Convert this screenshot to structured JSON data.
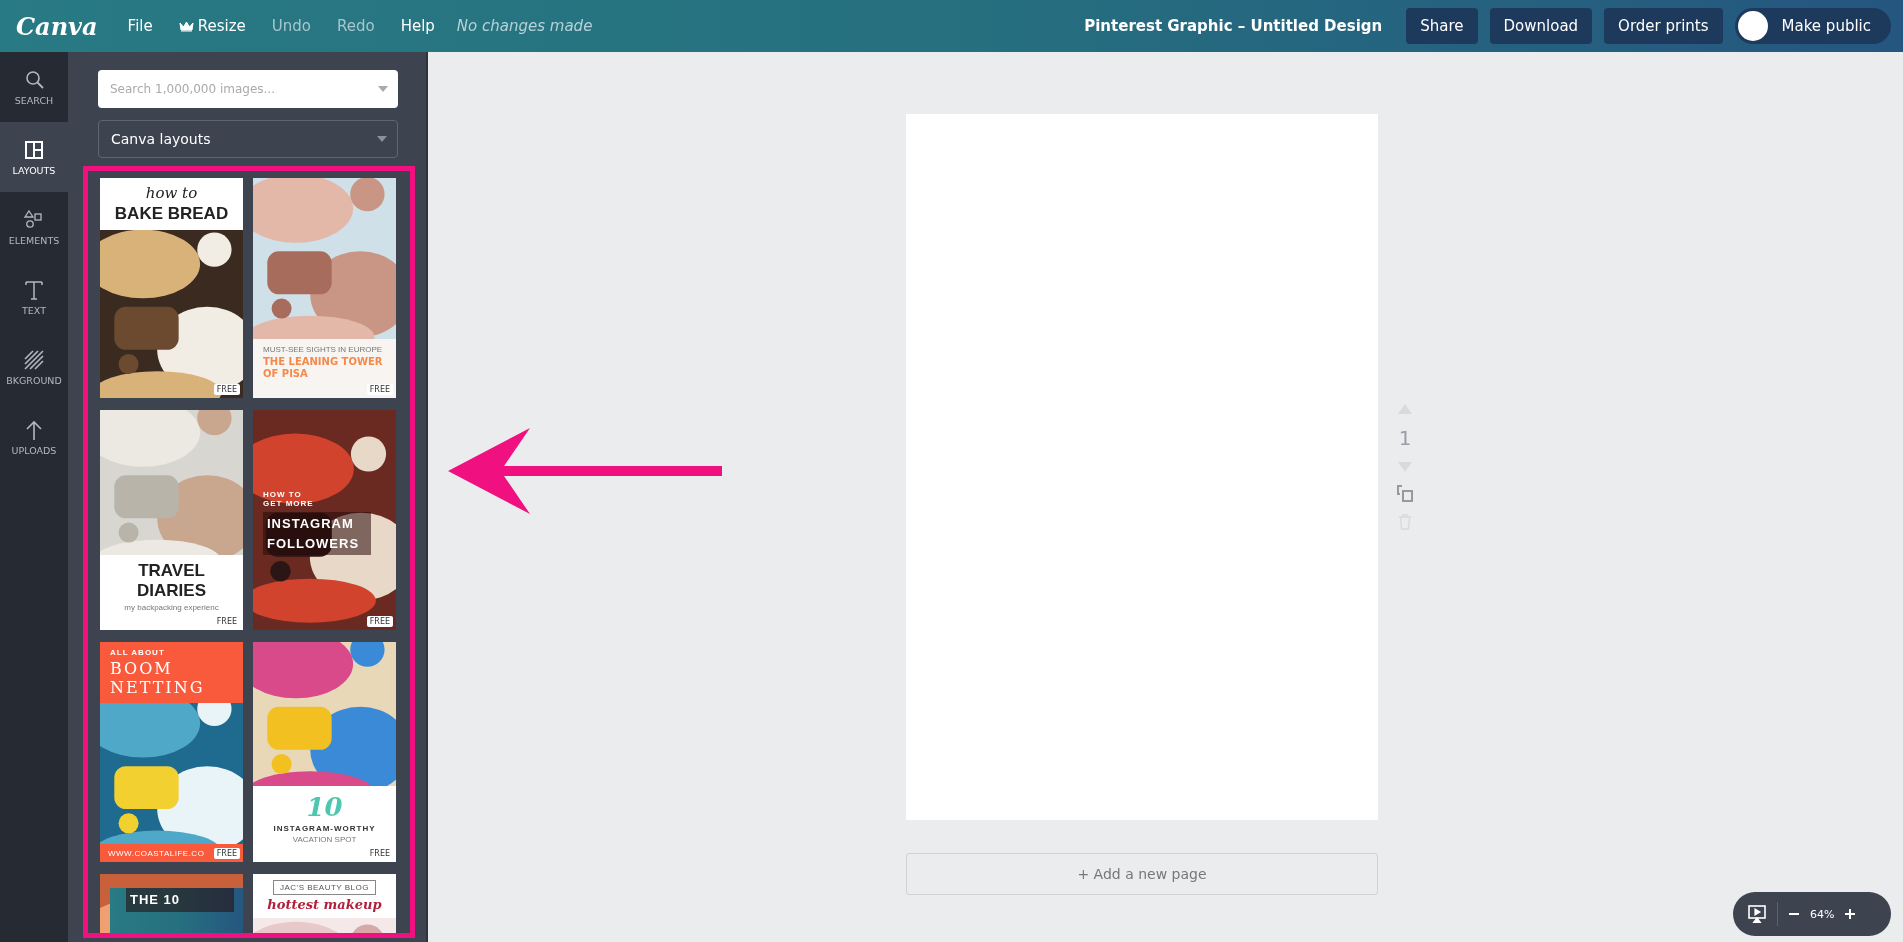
{
  "topbar": {
    "logo": "Canva",
    "menu": [
      {
        "label": "File",
        "kind": "plain",
        "disabled": false
      },
      {
        "label": "Resize",
        "kind": "crown",
        "disabled": false
      },
      {
        "label": "Undo",
        "kind": "plain",
        "disabled": true
      },
      {
        "label": "Redo",
        "kind": "plain",
        "disabled": true
      },
      {
        "label": "Help",
        "kind": "plain",
        "disabled": false
      }
    ],
    "status": "No changes made",
    "design_title": "Pinterest Graphic – Untitled Design",
    "buttons": [
      "Share",
      "Download",
      "Order prints"
    ],
    "public_toggle": {
      "label": "Make public",
      "on": false
    }
  },
  "rail": [
    {
      "label": "SEARCH",
      "selected": false
    },
    {
      "label": "LAYOUTS",
      "selected": true
    },
    {
      "label": "ELEMENTS",
      "selected": false
    },
    {
      "label": "TEXT",
      "selected": false
    },
    {
      "label": "BKGROUND",
      "selected": false
    },
    {
      "label": "UPLOADS",
      "selected": false
    }
  ],
  "panel": {
    "search": {
      "placeholder": "Search 1,000,000 images..."
    },
    "source": {
      "value": "Canva layouts"
    },
    "templates": [
      {
        "lines": [
          "how to",
          "BAKE BREAD"
        ],
        "badge": "FREE"
      },
      {
        "lines": [
          "MUST-SEE SIGHTS IN EUROPE",
          "THE LEANING TOWER OF PISA"
        ],
        "badge": "FREE"
      },
      {
        "lines": [
          "TRAVEL DIARIES",
          "my backpacking experienc"
        ],
        "badge": "FREE"
      },
      {
        "lines": [
          "HOW TO GET MORE",
          "INSTAGRAM FOLLOWERS"
        ],
        "badge": "FREE"
      },
      {
        "lines": [
          "ALL ABOUT",
          "BOOM NETTING"
        ],
        "footnote": "WWW.COASTALIFE.CO",
        "badge": "FREE"
      },
      {
        "lines": [
          "10",
          "INSTAGRAM-WORTHY",
          "VACATION SPOT"
        ],
        "badge": "FREE"
      },
      {
        "lines": [
          "THE 10"
        ]
      },
      {
        "lines": [
          "JAC'S BEAUTY BLOG",
          "hottest makeup"
        ]
      }
    ]
  },
  "page_tools": {
    "page_number": "1"
  },
  "add_page": "+ Add a new page",
  "zoom": {
    "value": "64%"
  }
}
